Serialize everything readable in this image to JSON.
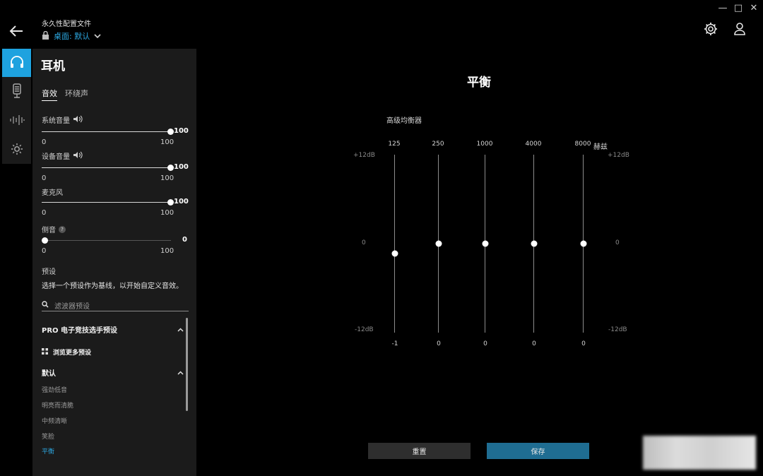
{
  "window": {
    "minimize": "—",
    "maximize": "□",
    "close": "✕"
  },
  "header": {
    "profile_title": "永久性配置文件",
    "profile_name": "桌面: 默认"
  },
  "panel": {
    "title": "耳机",
    "tabs": [
      {
        "label": "音效",
        "active": true
      },
      {
        "label": "环绕声",
        "active": false
      }
    ],
    "sliders": [
      {
        "label": "系统音量",
        "value": "100",
        "min": "0",
        "max": "100",
        "level": 1.0
      },
      {
        "label": "设备音量",
        "value": "100",
        "min": "0",
        "max": "100",
        "level": 1.0
      },
      {
        "label": "麦克风",
        "value": "100",
        "min": "0",
        "max": "100",
        "level": 1.0
      },
      {
        "label": "侧音",
        "value": "0",
        "min": "0",
        "max": "100",
        "level": 0.0
      }
    ],
    "sidetone_help": "?",
    "presets_heading": "预设",
    "presets_hint": "选择一个预设作为基线，以开始自定义音效。",
    "search_placeholder": "滤波器预设",
    "group_pro": "PRO 电子竞技选手预设",
    "browse_more": "浏览更多预设",
    "group_default": "默认",
    "presets": [
      "强劲低音",
      "明亮而清脆",
      "中频清晰",
      "笑脸",
      "平衡"
    ],
    "active_preset": "平衡"
  },
  "eq": {
    "title": "平衡",
    "subtitle": "高级均衡器",
    "unit": "赫兹",
    "db_top": "+12dB",
    "db_mid": "0",
    "db_bottom": "-12dB",
    "range": [
      -12,
      12
    ],
    "bands": [
      {
        "freq": "125",
        "value": -1
      },
      {
        "freq": "250",
        "value": 0
      },
      {
        "freq": "1000",
        "value": 0
      },
      {
        "freq": "4000",
        "value": 0
      },
      {
        "freq": "8000",
        "value": 0
      }
    ]
  },
  "buttons": {
    "reset": "重置",
    "save": "保存"
  },
  "colors": {
    "accent": "#1ea2df",
    "link": "#2ca7e0",
    "save_bg": "#1f6d92"
  }
}
